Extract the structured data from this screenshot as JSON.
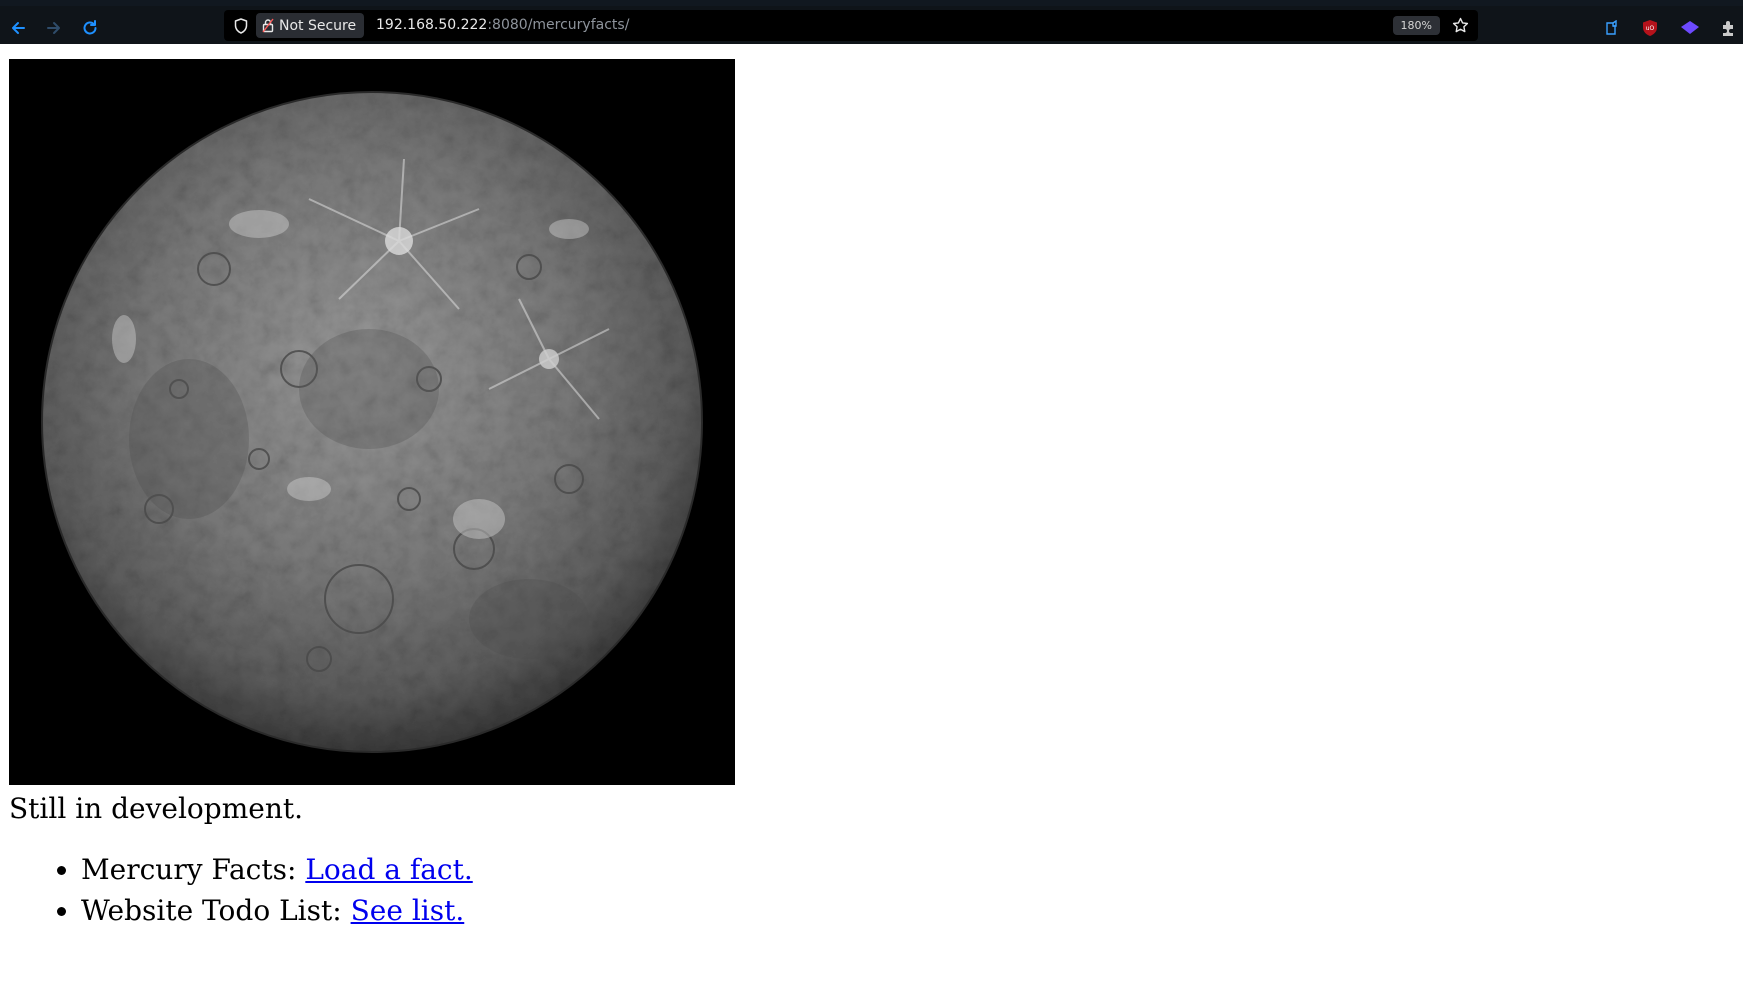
{
  "browser": {
    "security_label": "Not Secure",
    "url_host": "192.168.50.222",
    "url_rest": ":8080/mercuryfacts/",
    "zoom": "180%",
    "icons": [
      "back-arrow-icon",
      "forward-arrow-icon",
      "reload-icon",
      "shield-icon",
      "lock-icon",
      "star-icon",
      "extensions-icon",
      "ublock-icon",
      "proton-vpn-icon",
      "puzzle-icon"
    ]
  },
  "page": {
    "status": "Still in development.",
    "links": [
      {
        "label": "Mercury Facts: ",
        "link_text": "Load a fact."
      },
      {
        "label": "Website Todo List: ",
        "link_text": "See list."
      }
    ]
  },
  "colors": {
    "link": "#0000ee",
    "chrome_bg": "#0f1419",
    "accent_blue": "#1e90ff"
  }
}
